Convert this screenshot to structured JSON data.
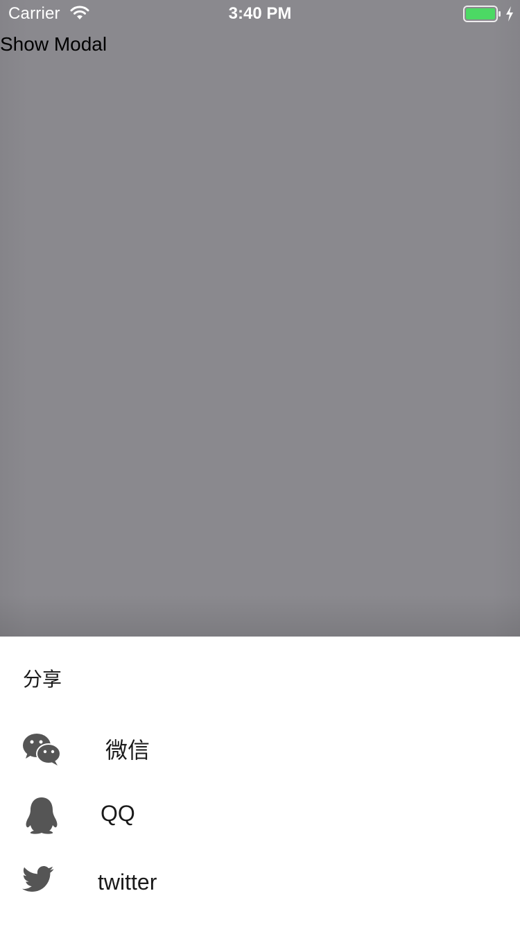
{
  "status_bar": {
    "carrier": "Carrier",
    "time": "3:40 PM"
  },
  "main": {
    "show_modal_label": "Show Modal"
  },
  "sheet": {
    "title": "分享",
    "items": [
      {
        "label": "微信",
        "icon": "wechat-icon"
      },
      {
        "label": "QQ",
        "icon": "qq-icon"
      },
      {
        "label": "twitter",
        "icon": "twitter-icon"
      }
    ]
  },
  "colors": {
    "backdrop": "#8a898e",
    "sheet_background": "#ffffff",
    "icon_gray": "#555555",
    "battery_green": "#4cd964"
  }
}
